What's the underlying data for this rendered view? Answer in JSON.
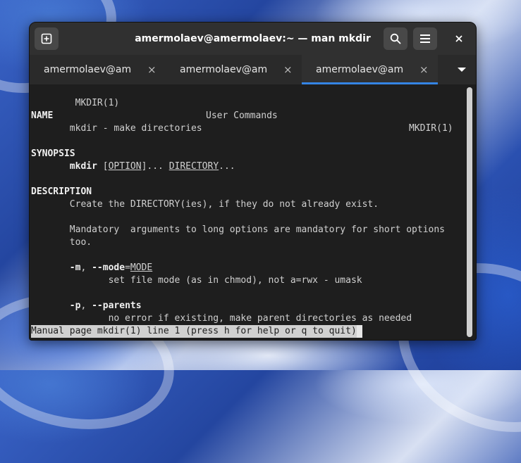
{
  "window": {
    "title": "amermolaev@amermolaev:~ — man mkdir"
  },
  "icons": {
    "new_tab": "new-tab-icon",
    "search": "search-icon",
    "menu": "hamburger-menu-icon",
    "close": "close-icon",
    "tab_overflow": "chevron-down-icon"
  },
  "tabs": [
    {
      "label": "amermolaev@amermolaev:~",
      "close": "×",
      "active": false
    },
    {
      "label": "amermolaev@amermolaev:~",
      "close": "×",
      "active": false
    },
    {
      "label": "amermolaev@amermolaev:~",
      "close": "×",
      "active": true
    }
  ],
  "terminal": {
    "header": {
      "left": "MKDIR(1)",
      "center": "User Commands",
      "right": "MKDIR(1)"
    },
    "name_heading": "NAME",
    "name_desc": "mkdir - make directories",
    "synopsis_heading": "SYNOPSIS",
    "synopsis_cmd": "mkdir",
    "synopsis_option": "OPTION",
    "synopsis_dots1": "...",
    "synopsis_directory": "DIRECTORY",
    "synopsis_dots2": "...",
    "description_heading": "DESCRIPTION",
    "desc_line1": "Create the DIRECTORY(ies), if they do not already exist.",
    "desc_line2": "Mandatory  arguments to long options are mandatory for short options",
    "desc_line3": "too.",
    "opt_m_short": "-m",
    "opt_m_long": "--mode",
    "opt_m_arg": "MODE",
    "opt_m_desc": "set file mode (as in chmod), not a=rwx - umask",
    "opt_p_short": "-p",
    "opt_p_long": "--parents",
    "opt_p_desc": "no error if existing, make parent directories as needed",
    "status_line": "Manual page mkdir(1) line 1 (press h for help or q to quit)"
  },
  "colors": {
    "accent": "#3584e4",
    "terminal_bg": "#1e1e1e",
    "titlebar_bg": "#303030"
  }
}
